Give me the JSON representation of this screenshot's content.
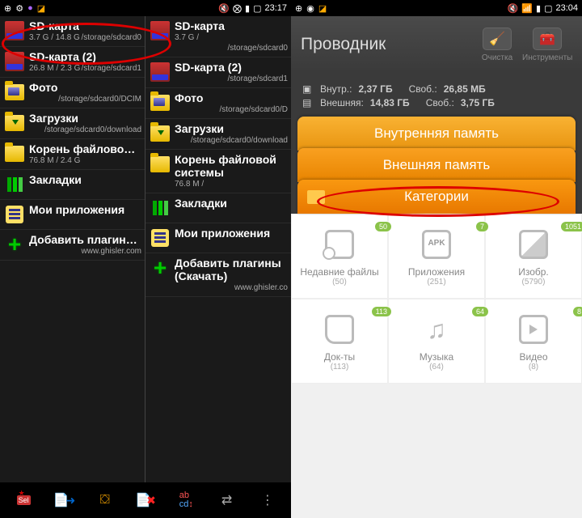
{
  "left": {
    "time": "23:17",
    "col1": [
      {
        "icon": "sd",
        "title": "SD-карта",
        "sub1": "3.7 G / 14.8 G",
        "sub2": "/storage/sdcard0"
      },
      {
        "icon": "sd",
        "title": "SD-карта (2)",
        "sub1": "26.8 M / 2.3 G",
        "sub2": "/storage/sdcard1"
      },
      {
        "icon": "folder-img",
        "title": "Фото",
        "sub1": "",
        "sub2": "/storage/sdcard0/DCIM"
      },
      {
        "icon": "folder-dl",
        "title": "Загрузки",
        "sub1": "",
        "sub2": "/storage/sdcard0/download"
      },
      {
        "icon": "folder",
        "title": "Корень файловой системы",
        "sub1": "76.8 M / 2.4 G",
        "sub2": ""
      },
      {
        "icon": "bookmark",
        "title": "Закладки",
        "sub1": "",
        "sub2": ""
      },
      {
        "icon": "apps",
        "title": "Мои приложения",
        "sub1": "",
        "sub2": ""
      },
      {
        "icon": "plus",
        "title": "Добавить плагины (Скачать)",
        "sub1": "",
        "sub2": "www.ghisler.com"
      }
    ],
    "col2": [
      {
        "icon": "sd",
        "title": "SD-карта",
        "sub1": "3.7 G /",
        "sub2": "/storage/sdcard0"
      },
      {
        "icon": "sd",
        "title": "SD-карта (2)",
        "sub1": "",
        "sub2": "/storage/sdcard1"
      },
      {
        "icon": "folder-img",
        "title": "Фото",
        "sub1": "",
        "sub2": "/storage/sdcard0/D"
      },
      {
        "icon": "folder-dl",
        "title": "Загрузки",
        "sub1": "",
        "sub2": "/storage/sdcard0/download"
      },
      {
        "icon": "folder",
        "title": "Корень файловой системы",
        "sub1": "76.8 M /",
        "sub2": ""
      },
      {
        "icon": "bookmark",
        "title": "Закладки",
        "sub1": "",
        "sub2": ""
      },
      {
        "icon": "apps",
        "title": "Мои приложения",
        "sub1": "",
        "sub2": ""
      },
      {
        "icon": "plus",
        "title": "Добавить плагины (Скачать)",
        "sub1": "",
        "sub2": "www.ghisler.co"
      }
    ]
  },
  "right": {
    "time": "23:04",
    "header": {
      "title": "Проводник",
      "btn1": "Очистка",
      "btn2": "Инструменты"
    },
    "storage": {
      "row1a": "Внутр.:",
      "row1b": "2,37 ГБ",
      "row1c": "Своб.:",
      "row1d": "26,85 МБ",
      "row2a": "Внешняя:",
      "row2b": "14,83 ГБ",
      "row2c": "Своб.:",
      "row2d": "3,75 ГБ"
    },
    "tabs": {
      "t1": "Внутренняя память",
      "t2": "Внешняя память",
      "t3": "Категории"
    },
    "grid": [
      {
        "title": "Недавние файлы",
        "count": "(50)",
        "badge": "50",
        "shape": "doc-clock"
      },
      {
        "title": "Приложения",
        "count": "(251)",
        "badge": "7",
        "shape": "apk"
      },
      {
        "title": "Изобр.",
        "count": "(5790)",
        "badge": "1051",
        "shape": "img"
      },
      {
        "title": "Док-ты",
        "count": "(113)",
        "badge": "113",
        "shape": "doc"
      },
      {
        "title": "Музыка",
        "count": "(64)",
        "badge": "64",
        "shape": "music"
      },
      {
        "title": "Видео",
        "count": "(8)",
        "badge": "8",
        "shape": "video"
      }
    ]
  }
}
